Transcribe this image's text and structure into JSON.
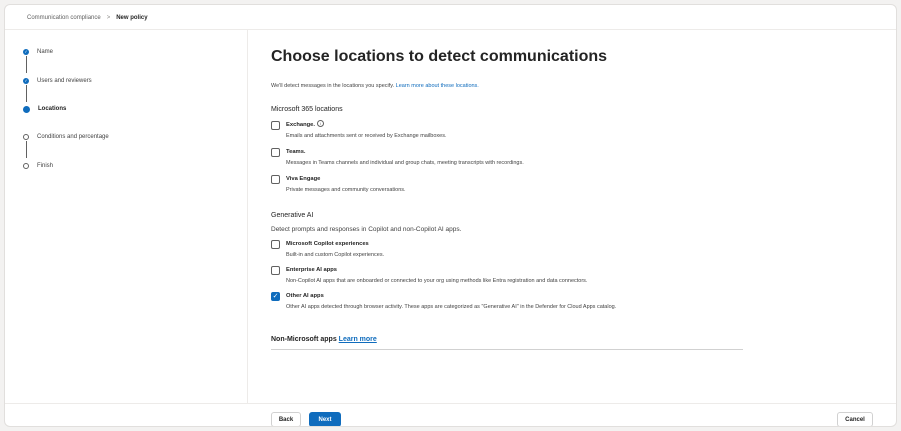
{
  "breadcrumb": {
    "parent": "Communication compliance",
    "separator": ">",
    "current": "New policy"
  },
  "steps": [
    {
      "label": "Name",
      "state": "done"
    },
    {
      "label": "Users and reviewers",
      "state": "done"
    },
    {
      "label": "Locations",
      "state": "current"
    },
    {
      "label": "Conditions and percentage",
      "state": "todo"
    },
    {
      "label": "Finish",
      "state": "todo"
    }
  ],
  "main": {
    "title": "Choose locations to detect communications",
    "intro_text": "We'll detect messages in the locations you specify. ",
    "intro_link": "Learn more about these locations.",
    "m365": {
      "heading": "Microsoft 365 locations",
      "options": [
        {
          "label": "Exchange.",
          "description": "Emails and attachments sent or received by Exchange mailboxes.",
          "checked": false,
          "info": true
        },
        {
          "label": "Teams.",
          "description": "Messages in Teams channels and individual and group chats, meeting transcripts with recordings.",
          "checked": false
        },
        {
          "label": "Viva Engage",
          "description": "Private messages and community conversations.",
          "checked": false
        }
      ]
    },
    "genai": {
      "heading": "Generative AI",
      "description": "Detect prompts and responses in Copilot and non-Copilot AI apps.",
      "options": [
        {
          "label": "Microsoft Copilot experiences",
          "description": "Built-in and custom Copilot experiences.",
          "checked": false
        },
        {
          "label": "Enterprise AI apps",
          "description": "Non-Copilot AI apps that are onboarded or connected to your org using methods like Entra registration and data connectors.",
          "checked": false
        },
        {
          "label": "Other AI apps",
          "description": "Other AI apps detected through browser activity. These apps are categorized as \"Generative AI\" in the Defender for Cloud Apps catalog.",
          "checked": true
        }
      ]
    },
    "nonms": {
      "label": "Non-Microsoft apps ",
      "link": "Learn more"
    }
  },
  "footer": {
    "back": "Back",
    "next": "Next",
    "cancel": "Cancel"
  },
  "colors": {
    "accent": "#0f6cbd",
    "text": "#242424"
  }
}
